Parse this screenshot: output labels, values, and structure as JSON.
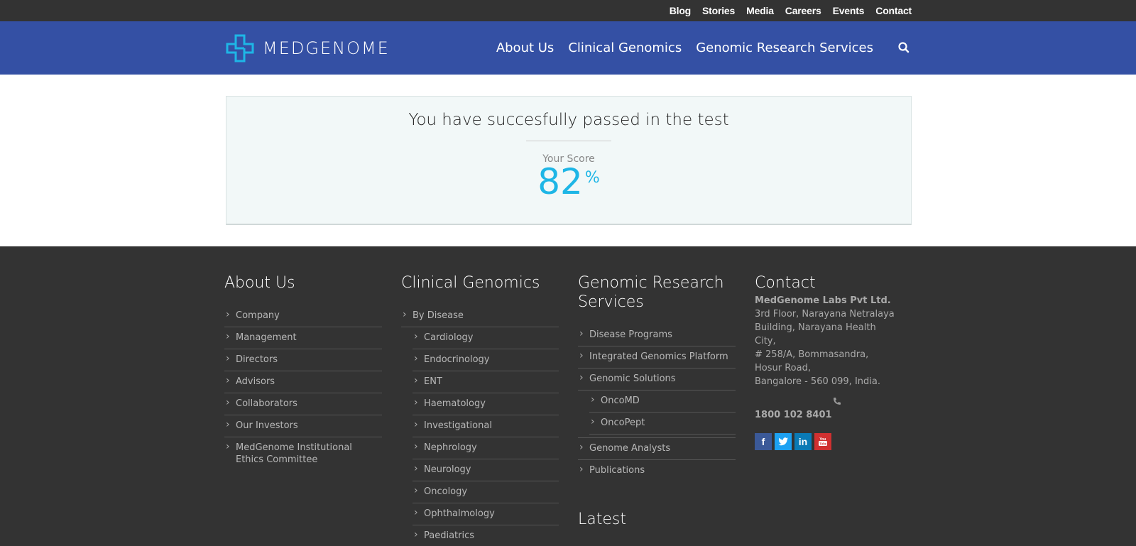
{
  "topbar": {
    "links": [
      "Blog",
      "Stories",
      "Media",
      "Careers",
      "Events",
      "Contact"
    ]
  },
  "header": {
    "logo_text": "MEDGENOME",
    "nav": [
      "About Us",
      "Clinical Genomics",
      "Genomic Research Services"
    ],
    "icons": {
      "search": "search-icon",
      "logo": "medgenome-logo-icon"
    },
    "colors": {
      "header_bg": "#3450a4",
      "topbar_bg": "#333333",
      "accent": "#1eb6e6"
    }
  },
  "result": {
    "title": "You have succesfully passed in the test",
    "score_label": "Your Score",
    "score_value": "82",
    "score_unit": "%"
  },
  "footer": {
    "about": {
      "heading": "About Us",
      "items": [
        "Company",
        "Management",
        "Directors",
        "Advisors",
        "Collaborators",
        "Our Investors",
        "MedGenome Institutional Ethics Committee"
      ]
    },
    "clinical": {
      "heading": "Clinical Genomics",
      "top_item": "By Disease",
      "items": [
        "Cardiology",
        "Endocrinology",
        "ENT",
        "Haematology",
        "Investigational",
        "Nephrology",
        "Neurology",
        "Oncology",
        "Ophthalmology",
        "Paediatrics"
      ]
    },
    "research": {
      "heading": "Genomic Research Services",
      "items": [
        "Disease Programs",
        "Integrated Genomics Platform",
        "Genomic Solutions"
      ],
      "sub_items": [
        "OncoMD",
        "OncoPept"
      ],
      "items_after": [
        "Genome Analysts",
        "Publications"
      ]
    },
    "latest_heading": "Latest",
    "contact": {
      "heading": "Contact",
      "company": "MedGenome Labs Pvt Ltd.",
      "address_lines": [
        "3rd Floor, Narayana Netralaya",
        "Building, Narayana Health City,",
        "# 258/A, Bommasandra,",
        "Hosur Road,",
        "Bangalore - 560 099, India."
      ],
      "phone": "1800 102 8401",
      "social": [
        "facebook-icon",
        "twitter-icon",
        "linkedin-icon",
        "youtube-icon"
      ]
    }
  }
}
